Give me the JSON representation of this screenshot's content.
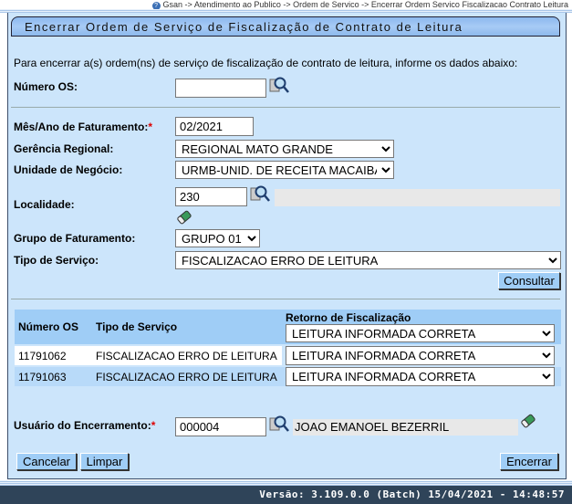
{
  "breadcrumb": "Gsan -> Atendimento ao Publico -> Ordem de Servico -> Encerrar Ordem Servico Fiscalizacao Contrato Leitura",
  "title": "Encerrar Ordem de Serviço de Fiscalização de Contrato de Leitura",
  "intro": "Para encerrar a(s) ordem(ns) de serviço de fiscalização de contrato de leitura, informe os dados abaixo:",
  "form": {
    "numero_os_label": "Número OS:",
    "numero_os_value": "",
    "mes_ano_label": "Mês/Ano de Faturamento:",
    "required_mark": "*",
    "mes_ano_value": "02/2021",
    "gerencia_label": "Gerência Regional:",
    "gerencia_value": "REGIONAL MATO GRANDE",
    "unidade_label": "Unidade de Negócio:",
    "unidade_value": "URMB-UNID. DE RECEITA MACAIBA",
    "localidade_label": "Localidade:",
    "localidade_value": "230",
    "localidade_desc": "",
    "grupo_label": "Grupo de Faturamento:",
    "grupo_value": "GRUPO 01",
    "tipo_label": "Tipo de Serviço:",
    "tipo_value": "FISCALIZACAO ERRO DE LEITURA",
    "consultar": "Consultar"
  },
  "table": {
    "headers": [
      "Número OS",
      "Tipo de Serviço",
      "Retorno de Fiscalização"
    ],
    "header_select": "LEITURA INFORMADA CORRETA",
    "rows": [
      {
        "numero": "11791062",
        "tipo": "FISCALIZACAO ERRO DE LEITURA",
        "retorno": "LEITURA INFORMADA CORRETA"
      },
      {
        "numero": "11791063",
        "tipo": "FISCALIZACAO ERRO DE LEITURA",
        "retorno": "LEITURA INFORMADA CORRETA"
      }
    ]
  },
  "usuario": {
    "label": "Usuário do Encerramento:",
    "value": "000004",
    "name": "JOAO EMANOEL BEZERRIL"
  },
  "buttons": {
    "cancelar": "Cancelar",
    "limpar": "Limpar",
    "encerrar": "Encerrar"
  },
  "footer": "Versão: 3.109.0.0 (Batch) 15/04/2021 - 14:48:57"
}
